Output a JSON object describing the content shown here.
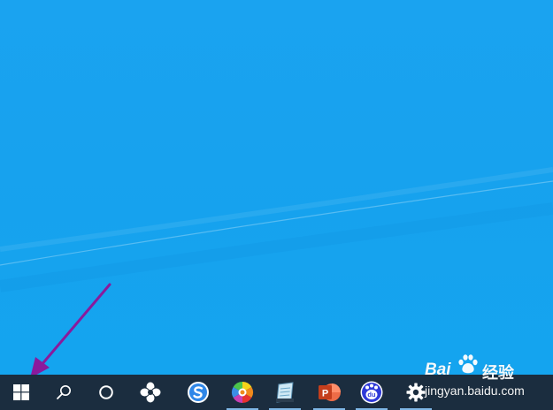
{
  "desktop": {
    "background_color": "#1aa3f0",
    "annotation_arrow_color": "#8a1a9c"
  },
  "taskbar": {
    "background_color": "#1b2d3f",
    "items": [
      {
        "name": "start-button",
        "icon": "windows-logo-icon"
      },
      {
        "name": "search-button",
        "icon": "search-icon"
      },
      {
        "name": "cortana-button",
        "icon": "cortana-circle-icon"
      },
      {
        "name": "app-1",
        "icon": "flower-app-icon"
      },
      {
        "name": "app-sogou",
        "icon": "s-browser-icon"
      },
      {
        "name": "app-colorwheel",
        "icon": "color-wheel-icon",
        "active": true
      },
      {
        "name": "app-notepad",
        "icon": "notepad-icon",
        "active": true
      },
      {
        "name": "app-powerpoint",
        "icon": "powerpoint-icon",
        "active": true
      },
      {
        "name": "app-baidu",
        "icon": "baidu-paw-icon",
        "active": true
      },
      {
        "name": "app-settings",
        "icon": "gear-icon",
        "active": true
      }
    ]
  },
  "watermark": {
    "brand": "Bai",
    "brand_suffix": "经验",
    "url": "jingyan.baidu.com"
  }
}
